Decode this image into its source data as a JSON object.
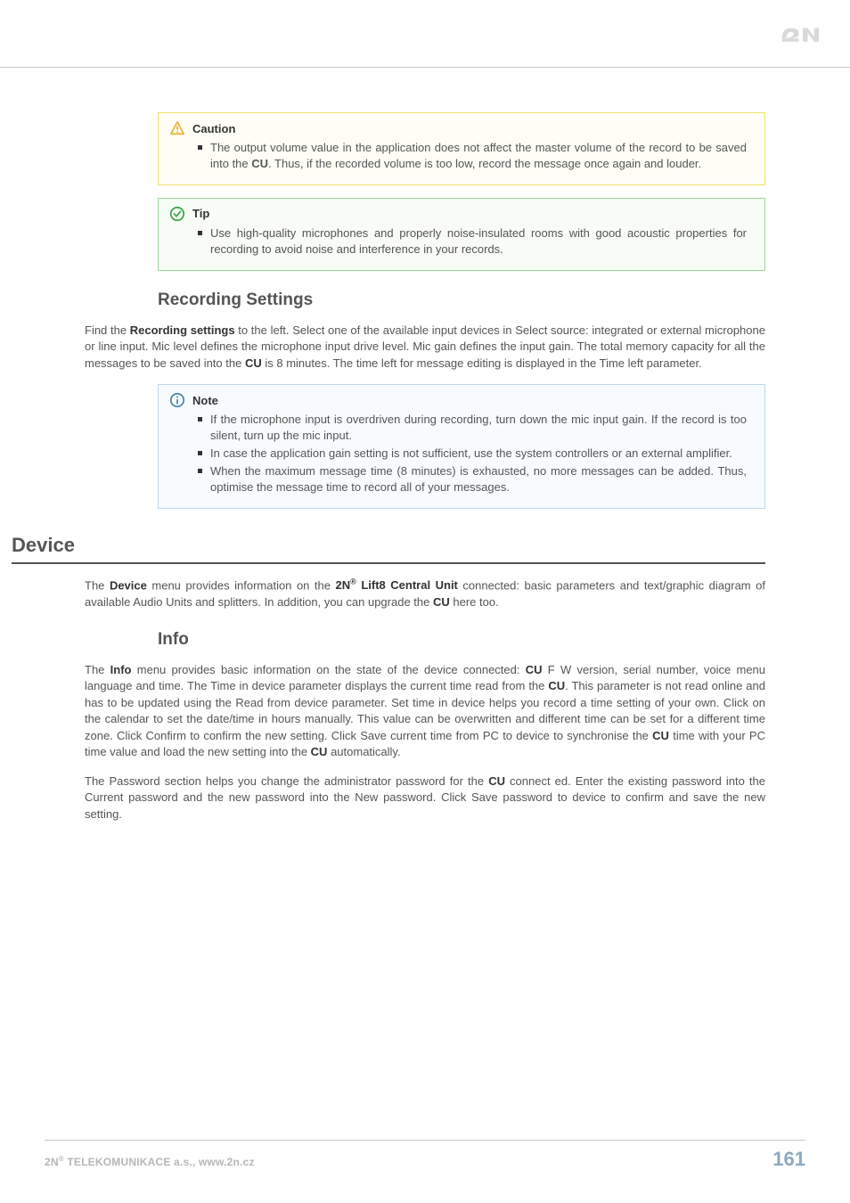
{
  "callouts": {
    "caution": {
      "title": "Caution",
      "items": [
        "The output volume value in the application does not affect the master volume of the record to be saved into the <b>CU</b>. Thus, if the recorded volume is too low, record the message once again and louder."
      ]
    },
    "tip": {
      "title": "Tip",
      "items": [
        "Use high-quality microphones and properly noise-insulated rooms with good acoustic properties for recording to avoid noise and interference in your records."
      ]
    },
    "note": {
      "title": "Note",
      "items": [
        "If the microphone input is overdriven during recording, turn down the mic input gain. If the record is too silent, turn up the mic input.",
        "In case the application gain setting is not sufficient, use the system controllers or an external amplifier.",
        "When the maximum message time (8 minutes) is exhausted, no more messages can be added. Thus, optimise the message time to record all of your messages."
      ]
    }
  },
  "headings": {
    "recording_settings": "Recording Settings",
    "device": "Device",
    "info": "Info"
  },
  "paragraphs": {
    "recording_settings": "Find the <b>Recording settings</b> to the left. Select one of the available input devices in Select source: integrated or external microphone or line input. Mic level defines the microphone input drive level. Mic gain defines the input gain. The total memory capacity for all the messages to be saved into the <b>CU</b> is 8 minutes. The time left for message editing is displayed in the Time left parameter.",
    "device_intro": "The <b>Device</b> menu provides information on the <b>2N<span class=\"sup\">®</span> Lift8 Central Unit</b> connected: basic parameters and text/graphic diagram of available Audio Units and splitters. In addition, you can upgrade the <b>CU</b> here too.",
    "info_p1": "The <b>Info</b> menu provides basic information on the state of the device connected: <b>CU</b> F W version, serial number, voice menu language and time. The Time in device parameter displays the current time read from the <b>CU</b>. This parameter is not read online and has to be updated using the Read from device parameter. Set time in device helps you record a time setting of your own. Click on the calendar to set the date/time in hours manually. This value can be overwritten and different time can be set for a different time zone. Click Confirm to confirm the new setting. Click Save current time from PC to device to synchronise the <b>CU</b> time with your PC time value and load the new setting into the <b>CU</b> automatically.",
    "info_p2": "The Password section helps you change the administrator password for the <b>CU</b> connect ed. Enter the existing password into the Current password and the new password into the New password. Click Save password to device to confirm and save the new setting."
  },
  "footer": {
    "left_prefix": "2N",
    "left_sup": "®",
    "left_rest": " TELEKOMUNIKACE a.s., www.2n.cz",
    "page": "161"
  }
}
